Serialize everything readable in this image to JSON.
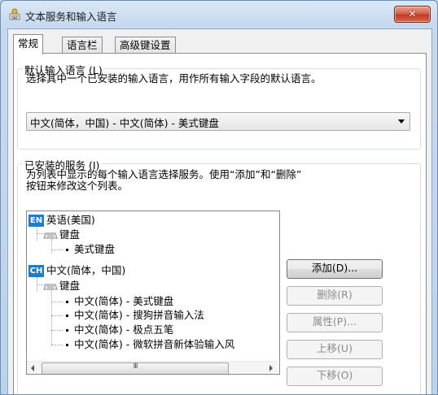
{
  "window": {
    "title": "文本服务和输入语言",
    "close_label": "✕"
  },
  "tabs": [
    {
      "label": "常规"
    },
    {
      "label": "语言栏"
    },
    {
      "label": "高级键设置"
    }
  ],
  "default_language": {
    "legend": "默认输入语言 (L)",
    "description": "选择其中一个已安装的输入语言，用作所有输入字段的默认语言。",
    "selected": "中文(简体，中国) - 中文(简体) - 美式键盘"
  },
  "installed_services": {
    "legend": "已安装的服务 (I)",
    "description_line1": "为列表中显示的每个输入语言选择服务。使用“添加”和“删除”",
    "description_line2": "按钮来修改这个列表。",
    "tree": {
      "en_badge": "EN",
      "en_label": "英语(美国)",
      "en_keyboard": "键盘",
      "en_items": [
        "美式键盘"
      ],
      "ch_badge": "CH",
      "ch_label": "中文(简体，中国)",
      "ch_keyboard": "键盘",
      "ch_items": [
        "中文(简体) - 美式键盘",
        "中文(简体) - 搜狗拼音输入法",
        "中文(简体) - 极点五笔",
        "中文(简体) - 微软拼音新体验输入风"
      ],
      "scroll_thumb": "III"
    },
    "buttons": {
      "add": "添加(D)...",
      "remove": "删除(R)",
      "properties": "属性(P)...",
      "move_up": "上移(U)",
      "move_down": "下移(O)"
    }
  }
}
